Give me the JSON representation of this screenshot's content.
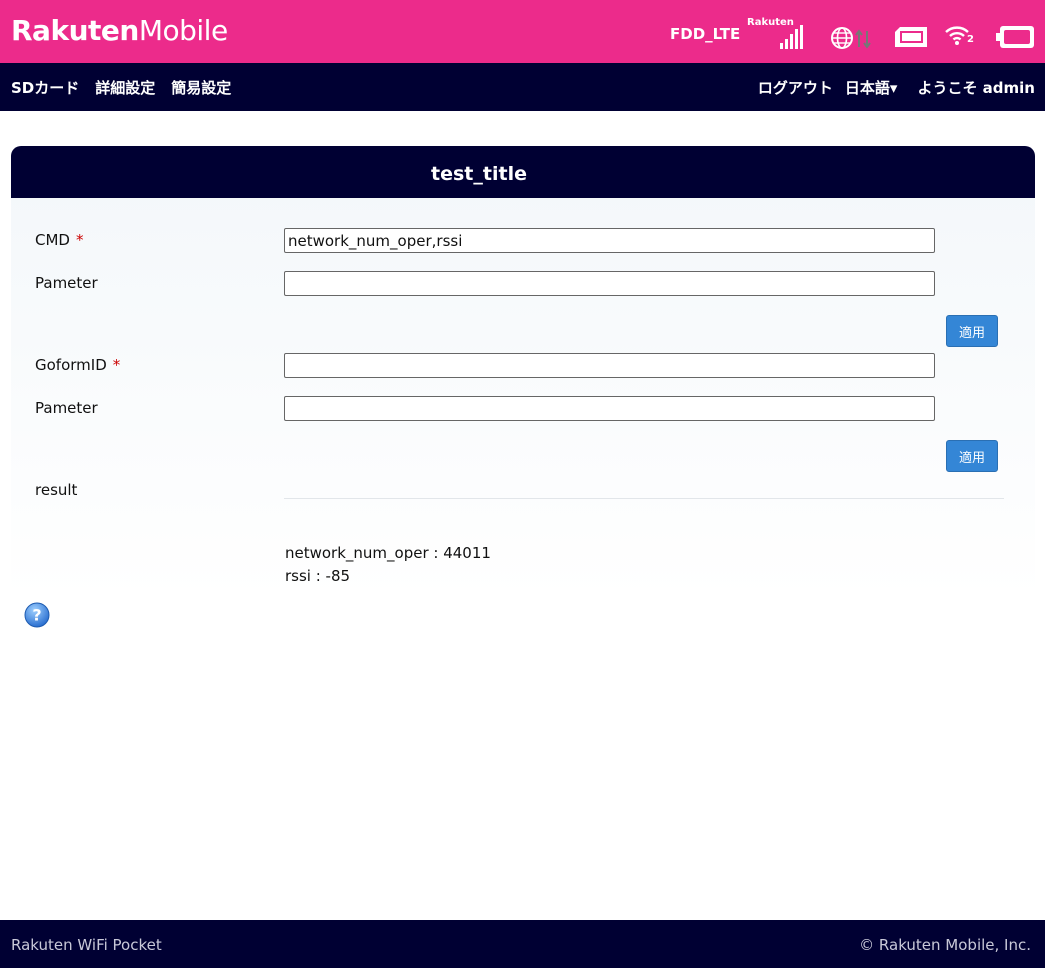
{
  "header": {
    "brand_bold": "Rakuten",
    "brand_light": "Mobile",
    "network_type": "FDD_LTE",
    "carrier": "Rakuten",
    "wifi_clients": "2",
    "colors": {
      "brand": "#ec2b8b",
      "nav": "#000033",
      "button": "#3486d6"
    }
  },
  "nav": {
    "left_items": [
      "SDカード",
      "詳細設定",
      "簡易設定"
    ],
    "logout": "ログアウト",
    "language": "日本語▾",
    "welcome": "ようこそ admin"
  },
  "panel": {
    "title": "test_title",
    "cmd_label": "CMD",
    "cmd_value": "network_num_oper,rssi",
    "param1_label": "Pameter",
    "param1_value": "",
    "apply1_label": "適用",
    "goform_label": "GoformID",
    "goform_value": "",
    "param2_label": "Pameter",
    "param2_value": "",
    "apply2_label": "適用",
    "result_label": "result",
    "result_line1": "network_num_oper : 44011",
    "result_line2": "rssi : -85",
    "required_mark": "*"
  },
  "footer": {
    "left": "Rakuten WiFi Pocket",
    "right": "© Rakuten Mobile, Inc."
  },
  "icons": [
    "signal-bars-icon",
    "globe-icon",
    "data-transfer-icon",
    "sim-card-icon",
    "wifi-icon",
    "battery-icon",
    "help-icon"
  ]
}
